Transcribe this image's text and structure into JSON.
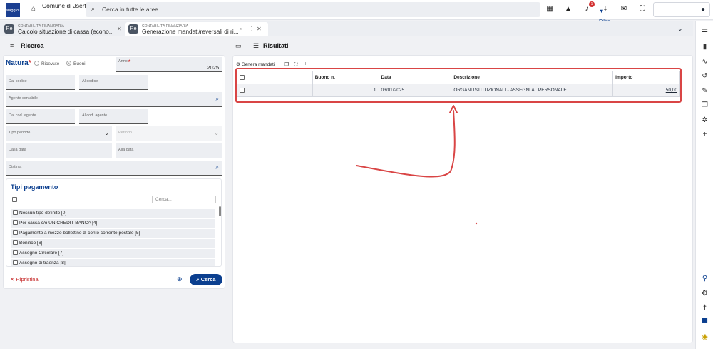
{
  "topbar": {
    "logo_text": "Maggioli",
    "comune": "Comune di Jserfin",
    "search_placeholder": "Cerca in tutte le aree...",
    "filter_label": "Filtra",
    "notification_count": "1"
  },
  "tabs": [
    {
      "category": "CONTABILITÀ FINANZIARIA",
      "title": "Calcolo situazione di cassa (econo..."
    },
    {
      "category": "CONTABILITÀ FINANZIARIA",
      "title": "Generazione mandati/reversali di ri..."
    }
  ],
  "left": {
    "header_title": "Ricerca",
    "natura_label": "Natura",
    "natura_options": [
      "Ricevute",
      "Buoni"
    ],
    "natura_selected": "Buoni",
    "anno_label": "Anno",
    "anno_value": "2025",
    "dal_codice": "Dal codice",
    "al_codice": "Al codice",
    "agente_contabile": "Agente contabile",
    "dal_cod_agente": "Dal cod. agente",
    "al_cod_agente": "Al cod. agente",
    "tipo_periodo": "Tipo periodo",
    "periodo": "Periodo",
    "dalla_data": "Dalla data",
    "alla_data": "Alla data",
    "distinta": "Distinta",
    "tipi_title": "Tipi pagamento",
    "tipi_search_placeholder": "Cerca...",
    "tipi_items": [
      "Nessun tipo definito [0]",
      "Per cassa c/o UNICREDIT BANCA [4]",
      "Pagamento a mezzo bollettino di conto corrente postale [5]",
      "Bonifico [6]",
      "Assegno Circolare [7]",
      "Assegno di traenza [8]"
    ],
    "ripristina": "Ripristina",
    "cerca": "Cerca"
  },
  "right": {
    "header_title": "Risultati",
    "toolbar_label": "Genera mandati",
    "columns": [
      "",
      "",
      "Buono n.",
      "Data",
      "Descrizione",
      "Importo"
    ],
    "rows": [
      {
        "col1": "",
        "buono": "1",
        "data": "03/01/2025",
        "descrizione": "ORGANI ISTITUZIONALI - ASSEGNI AL PERSONALE",
        "importo": "50,00"
      }
    ]
  },
  "colors": {
    "accent": "#0b3f8f",
    "danger": "#d32f2f",
    "annotation": "#d94545"
  }
}
